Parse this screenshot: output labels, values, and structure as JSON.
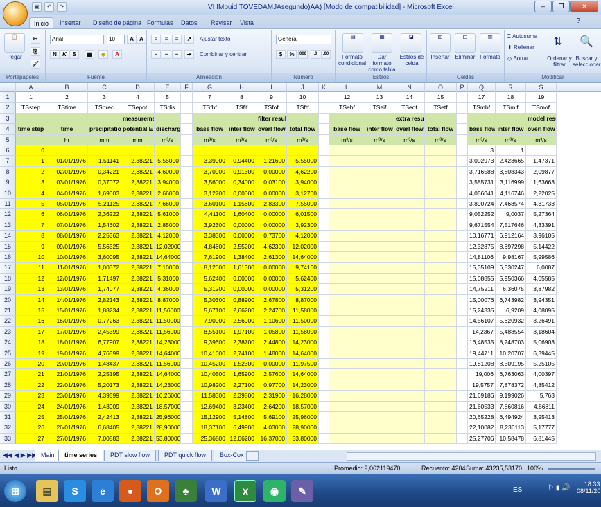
{
  "window": {
    "title": "VI IMbuid TOVEDAMJAsegundo)AA) [Modo de compatibilidad] - Microsoft Excel"
  },
  "ribbon_tabs": [
    "Inicio",
    "Insertar",
    "Diseño de página",
    "Fórmulas",
    "Datos",
    "Revisar",
    "Vista"
  ],
  "ribbon": {
    "paste": "Pegar",
    "font_name": "Arial",
    "font_size": "10",
    "wrap_text": "Ajustar texto",
    "merge_center": "Combinar y centrar",
    "number_format": "General",
    "cond_format": "Formato condicional",
    "format_table": "Dar formato como tabla",
    "cell_styles": "Estilos de celda",
    "insert": "Insertar",
    "delete": "Eliminar",
    "format": "Formato",
    "autosum": "Autosuma",
    "fill": "Rellenar",
    "clear": "Borrar",
    "sort_filter": "Ordenar y filtrar",
    "find_select": "Buscar y seleccionar",
    "groups": {
      "clipboard": "Portapapeles",
      "font": "Fuente",
      "alignment": "Alineación",
      "number": "Número",
      "styles": "Estilos",
      "cells": "Celdas",
      "editing": "Modificar"
    }
  },
  "columns": [
    "A",
    "B",
    "C",
    "D",
    "E",
    "F",
    "G",
    "H",
    "I",
    "J",
    "K",
    "L",
    "M",
    "N",
    "O",
    "P",
    "Q",
    "R",
    "S"
  ],
  "row1": [
    "1",
    "2",
    "3",
    "4",
    "5",
    "",
    "7",
    "8",
    "9",
    "10",
    "",
    "12",
    "13",
    "14",
    "15",
    "",
    "17",
    "18",
    "19"
  ],
  "row2": [
    "TSstep",
    "TStime",
    "TSprec",
    "TSepot",
    "TSdis",
    "",
    "TSfbf",
    "TSfif",
    "TSfof",
    "TSftf",
    "",
    "TSebf",
    "TSeif",
    "TSeof",
    "TSetf",
    "",
    "TSmbf",
    "TSmif",
    "TSmof"
  ],
  "row3_groups": {
    "measurements": "measurements",
    "filter": "filter results",
    "extra": "extra results",
    "model": "model results"
  },
  "row4": [
    "time step",
    "time",
    "precipitation",
    "potential ET",
    "discharge",
    "",
    "base flow",
    "inter flow",
    "overl flow",
    "total flow",
    "",
    "base flow",
    "inter flow",
    "overl flow",
    "total flow",
    "",
    "base flow",
    "inter flow",
    "overl flow"
  ],
  "row5": [
    "",
    "hr",
    "mm",
    "mm",
    "m³/s",
    "",
    "m³/s",
    "m³/s",
    "m³/s",
    "m³/s",
    "",
    "m³/s",
    "m³/s",
    "m³/s",
    "m³/s",
    "",
    "m³/s",
    "m³/s",
    "m³/s"
  ],
  "row6": [
    "0",
    "",
    "",
    "",
    "",
    "",
    "",
    "",
    "",
    "",
    "",
    "",
    "",
    "",
    "",
    "",
    "3",
    "1",
    ""
  ],
  "data": [
    [
      "1",
      "01/01/1976",
      "1,51141",
      "2,38221",
      "5,55000",
      "3,39000",
      "0,94400",
      "1,21600",
      "5,55000",
      "3,002973",
      "2,423665",
      "1,47371"
    ],
    [
      "2",
      "02/01/1976",
      "0,34221",
      "2,38221",
      "4,60000",
      "3,70900",
      "0,91300",
      "0,00000",
      "4,62200",
      "3,716588",
      "3,808343",
      "2,09877"
    ],
    [
      "3",
      "03/01/1976",
      "0,37072",
      "2,38221",
      "3,94000",
      "3,56000",
      "0,34000",
      "0,03100",
      "3,94000",
      "3,585731",
      "3,116999",
      "1,63663"
    ],
    [
      "4",
      "04/01/1976",
      "1,69003",
      "2,38221",
      "2,66000",
      "3,12700",
      "0,00000",
      "0,00000",
      "3,12700",
      "4,056041",
      "4,116746",
      "2,22025"
    ],
    [
      "5",
      "05/01/1976",
      "5,21125",
      "2,38221",
      "7,66000",
      "3,60100",
      "1,15600",
      "2,83300",
      "7,55000",
      "3,890724",
      "7,468574",
      "4,31733"
    ],
    [
      "6",
      "06/01/1976",
      "2,36222",
      "2,38221",
      "5,61000",
      "4,41100",
      "1,60400",
      "0,00000",
      "6,01500",
      "9,052252",
      "9,0037",
      "5,27364"
    ],
    [
      "7",
      "07/01/1976",
      "1,54602",
      "2,38221",
      "2,85000",
      "3,92300",
      "0,00000",
      "0,00000",
      "3,92300",
      "9,671554",
      "7,517646",
      "4,33391"
    ],
    [
      "8",
      "08/01/1976",
      "2,25363",
      "2,38221",
      "4,12000",
      "3,38300",
      "0,00000",
      "0,73700",
      "4,12000",
      "10,16771",
      "6,912164",
      "3,96105"
    ],
    [
      "9",
      "09/01/1976",
      "5,56525",
      "2,38221",
      "12,02000",
      "4,84600",
      "2,55200",
      "4,62300",
      "12,02000",
      "12,32875",
      "8,697298",
      "5,14422"
    ],
    [
      "10",
      "10/01/1976",
      "3,60095",
      "2,38221",
      "14,64000",
      "7,61900",
      "1,38400",
      "2,61300",
      "14,64000",
      "14,81106",
      "9,98167",
      "5,99586"
    ],
    [
      "11",
      "11/01/1976",
      "1,00372",
      "2,38221",
      "7,10000",
      "8,12000",
      "1,61300",
      "0,00000",
      "9,74100",
      "15,35109",
      "6,530247",
      "6,0087"
    ],
    [
      "12",
      "12/01/1976",
      "1,71497",
      "2,38221",
      "5,31000",
      "5,62400",
      "0,00000",
      "0,00000",
      "5,62400",
      "15,08855",
      "5,950366",
      "4,05585"
    ],
    [
      "13",
      "13/01/1976",
      "1,74077",
      "2,38221",
      "4,36000",
      "5,31200",
      "0,00000",
      "0,00000",
      "5,31200",
      "14,75211",
      "6,36075",
      "3,87982"
    ],
    [
      "14",
      "14/01/1976",
      "2,82143",
      "2,38221",
      "8,87000",
      "5,30300",
      "0,88900",
      "2,67800",
      "8,87000",
      "15,00076",
      "6,743982",
      "3,94351"
    ],
    [
      "15",
      "15/01/1976",
      "1,88234",
      "2,38221",
      "11,56000",
      "5,67100",
      "2,66200",
      "2,24700",
      "11,58000",
      "15,24335",
      "6,9209",
      "4,08095"
    ],
    [
      "16",
      "16/01/1976",
      "0,77263",
      "2,38221",
      "11,50000",
      "7,90000",
      "2,56900",
      "1,10600",
      "11,50000",
      "14,56107",
      "5,620932",
      "3,26491"
    ],
    [
      "17",
      "17/01/1976",
      "2,45399",
      "2,38221",
      "11,56000",
      "8,55100",
      "1,97100",
      "1,05800",
      "11,58000",
      "14,2367",
      "5,488554",
      "3,18604"
    ],
    [
      "18",
      "18/01/1976",
      "6,77907",
      "2,38221",
      "14,23000",
      "9,39600",
      "2,38700",
      "2,44800",
      "14,23000",
      "16,48535",
      "8,248703",
      "5,06903"
    ],
    [
      "19",
      "19/01/1976",
      "4,76599",
      "2,38221",
      "14,64000",
      "10,41000",
      "2,74100",
      "1,48000",
      "14,64000",
      "19,44711",
      "10,20707",
      "6,39445"
    ],
    [
      "20",
      "20/01/1976",
      "1,48437",
      "2,38221",
      "11,56000",
      "10,45200",
      "1,52300",
      "0,00000",
      "11,97500",
      "19,81208",
      "8,509195",
      "5,25105"
    ],
    [
      "21",
      "21/01/1976",
      "2,25195",
      "2,38221",
      "14,64000",
      "10,40500",
      "1,65900",
      "2,57600",
      "14,64000",
      "19,006",
      "6,763063",
      "4,00397"
    ],
    [
      "22",
      "22/01/1976",
      "5,20173",
      "2,38221",
      "14,23000",
      "10,98200",
      "2,27100",
      "0,97700",
      "14,23000",
      "19,5757",
      "7,878372",
      "4,85412"
    ],
    [
      "23",
      "23/01/1976",
      "4,39599",
      "2,38221",
      "16,26000",
      "11,58300",
      "2,39800",
      "2,31900",
      "16,28000",
      "21,69186",
      "9,199026",
      "5,763"
    ],
    [
      "24",
      "24/01/1976",
      "1,43009",
      "2,38221",
      "18,57000",
      "12,69400",
      "3,23400",
      "2,64200",
      "18,57000",
      "21,60533",
      "7,860816",
      "4,86811"
    ],
    [
      "25",
      "25/01/1976",
      "2,42413",
      "2,38221",
      "25,96000",
      "15,12900",
      "5,14800",
      "5,69100",
      "25,96000",
      "20,65228",
      "6,494924",
      "3,95413"
    ],
    [
      "26",
      "26/01/1976",
      "6,68405",
      "2,38221",
      "28,90000",
      "18,37100",
      "6,49900",
      "4,03000",
      "28,90000",
      "22,10082",
      "8,236113",
      "5,17777"
    ],
    [
      "27",
      "27/01/1976",
      "7,00883",
      "2,38221",
      "53,80000",
      "25,36800",
      "12,06200",
      "16,37000",
      "53,80000",
      "25,27706",
      "10,58478",
      "6,81445"
    ]
  ],
  "sheet_tabs": [
    "Main",
    "time series",
    "PDT slow flow",
    "PDT quick flow",
    "Box-Cox"
  ],
  "active_sheet": "time series",
  "status": {
    "ready": "Listo",
    "average": "Promedio: 9,062119470",
    "count": "Recuento: 4204",
    "sum": "Suma: 43235,53170",
    "zoom": "100%"
  },
  "taskbar": {
    "lang": "ES",
    "time": "18:33",
    "date": "08/11/2010"
  }
}
